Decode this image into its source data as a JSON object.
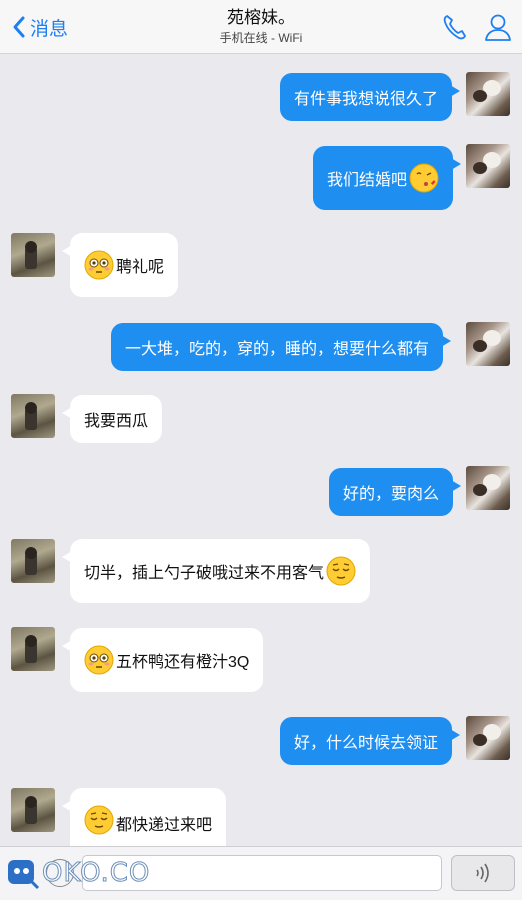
{
  "header": {
    "back_label": "消息",
    "title": "苑榕妹。",
    "subtitle": "手机在线 - WiFi",
    "icons": [
      "chevron-left-icon",
      "phone-icon",
      "person-icon"
    ],
    "accent_color": "#1e7ff2"
  },
  "messages": [
    {
      "sender": "me",
      "text": "有件事我想说很久了"
    },
    {
      "sender": "me",
      "text": "我们结婚吧",
      "emoji": "kissing-face-emoji"
    },
    {
      "sender": "them",
      "text": "聘礼呢",
      "emoji": "flushed-face-emoji"
    },
    {
      "sender": "me",
      "text": "一大堆，吃的，穿的，睡的，想要什么都有"
    },
    {
      "sender": "them",
      "text": "我要西瓜"
    },
    {
      "sender": "me",
      "text": "好的，要肉么"
    },
    {
      "sender": "them",
      "text": "切半，插上勺子破哦过来不用客气",
      "emoji": "relieved-face-emoji"
    },
    {
      "sender": "them",
      "text": "五杯鸭还有橙汁3Q",
      "emoji": "flushed-face-emoji"
    },
    {
      "sender": "me",
      "text": "好，什么时候去领证"
    },
    {
      "sender": "them",
      "text": "都快递过来吧",
      "emoji": "relieved-face-emoji"
    }
  ],
  "colors": {
    "my_bubble": "#1f8ef1",
    "their_bubble": "#ffffff",
    "background": "#e9e9ee"
  },
  "composer": {
    "input_value": "",
    "icons": [
      "voice-icon",
      "sound-waves-icon"
    ]
  },
  "watermark": {
    "text": "OKO.CO"
  }
}
